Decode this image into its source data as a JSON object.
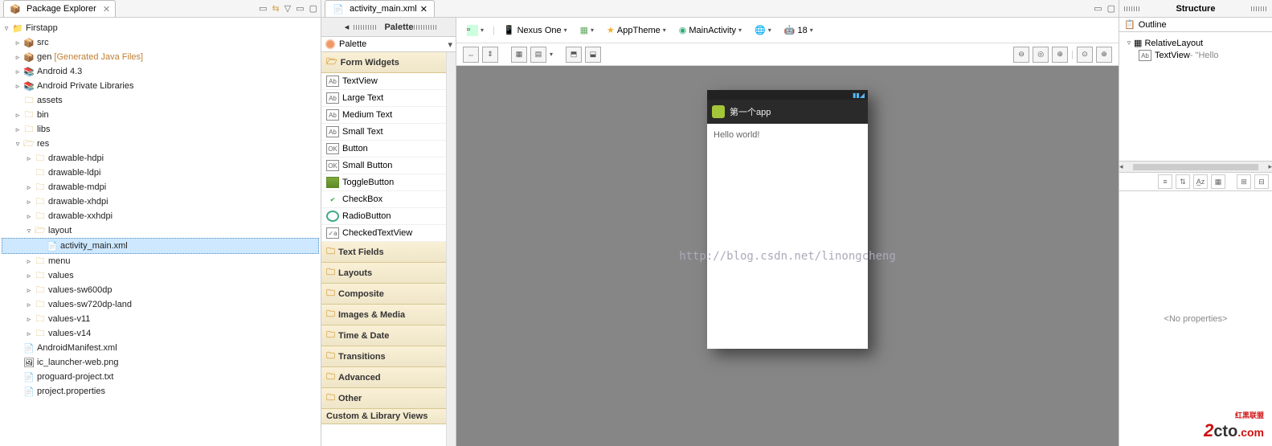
{
  "package_explorer": {
    "title": "Package Explorer",
    "tree": {
      "project": "Firstapp",
      "src": "src",
      "gen": "gen",
      "gen_suffix": "[Generated Java Files]",
      "android": "Android 4.3",
      "priv_libs": "Android Private Libraries",
      "assets": "assets",
      "bin": "bin",
      "libs": "libs",
      "res": "res",
      "drawable_hdpi": "drawable-hdpi",
      "drawable_ldpi": "drawable-ldpi",
      "drawable_mdpi": "drawable-mdpi",
      "drawable_xhdpi": "drawable-xhdpi",
      "drawable_xxhdpi": "drawable-xxhdpi",
      "layout": "layout",
      "activity_main": "activity_main.xml",
      "menu": "menu",
      "values": "values",
      "values_sw600dp": "values-sw600dp",
      "values_sw720dp_land": "values-sw720dp-land",
      "values_v11": "values-v11",
      "values_v14": "values-v14",
      "manifest": "AndroidManifest.xml",
      "launcher": "ic_launcher-web.png",
      "proguard": "proguard-project.txt",
      "project_props": "project.properties"
    }
  },
  "editor": {
    "tab": "activity_main.xml"
  },
  "palette": {
    "title": "Palette",
    "selector": "Palette",
    "categories": {
      "form_widgets": "Form Widgets",
      "text_fields": "Text Fields",
      "layouts": "Layouts",
      "composite": "Composite",
      "images_media": "Images & Media",
      "time_date": "Time & Date",
      "transitions": "Transitions",
      "advanced": "Advanced",
      "other": "Other",
      "custom": "Custom & Library Views"
    },
    "widgets": {
      "textview": "TextView",
      "large_text": "Large Text",
      "medium_text": "Medium Text",
      "small_text": "Small Text",
      "button": "Button",
      "small_button": "Small Button",
      "toggle_button": "ToggleButton",
      "checkbox": "CheckBox",
      "radio_button": "RadioButton",
      "checked_textview": "CheckedTextView"
    }
  },
  "config": {
    "device": "Nexus One",
    "theme": "AppTheme",
    "activity": "MainActivity",
    "api": "18"
  },
  "preview": {
    "app_title": "第一个app",
    "content": "Hello world!"
  },
  "watermark": "http://blog.csdn.net/linongcheng",
  "structure": {
    "title": "Structure",
    "outline": "Outline",
    "root": "RelativeLayout",
    "child": "TextView",
    "child_suffix": " - \"Hello",
    "no_props": "<No properties>"
  },
  "logo": {
    "two": "2",
    "cto": "cto",
    "com": ".com",
    "cn": "红黑联盟"
  }
}
